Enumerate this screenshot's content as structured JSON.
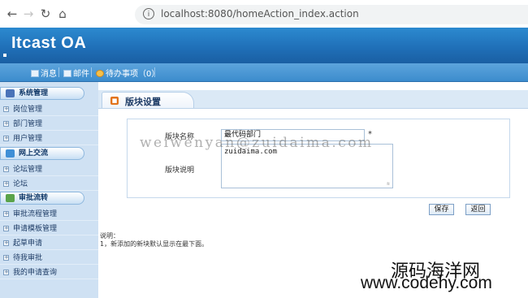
{
  "browser": {
    "url": "localhost:8080/homeAction_index.action",
    "back_icon": "arrow-left-icon",
    "forward_icon": "arrow-right-icon",
    "reload_icon": "reload-icon",
    "home_icon": "home-icon",
    "info_icon": "info-icon"
  },
  "header": {
    "logo": "Itcast OA"
  },
  "toolbar": {
    "messages": "消息",
    "mail": "邮件",
    "todo": "待办事项（0）"
  },
  "sidebar": {
    "groups": [
      {
        "label": "系统管理",
        "icon": "cube-icon",
        "items": [
          "岗位管理",
          "部门管理",
          "用户管理"
        ]
      },
      {
        "label": "网上交流",
        "icon": "chat-icon",
        "items": [
          "论坛管理",
          "论坛"
        ]
      },
      {
        "label": "审批流转",
        "icon": "flow-icon",
        "items": [
          "审批流程管理",
          "申请模板管理",
          "起草申请",
          "待我审批",
          "我的申请查询"
        ]
      }
    ]
  },
  "main": {
    "title": "版块设置",
    "form": {
      "name_label": "版块名称",
      "name_value": "最代码部门",
      "required_mark": "*",
      "desc_label": "版块说明",
      "desc_value": "zuidaima.com"
    },
    "buttons": {
      "save": "保存",
      "back": "返回"
    },
    "note_title": "说明：",
    "note_text": "1，新添加的新块默认显示在最下面。"
  },
  "watermarks": {
    "overlay": "weiwenyan@zuidaima.com",
    "site_cn": "源码海洋网",
    "site_url": "www.codehy.com"
  },
  "colors": {
    "header_blue": "#1f6eb6",
    "sidebar_bg": "#cfe1f3",
    "accent_orange": "#e2731b"
  }
}
